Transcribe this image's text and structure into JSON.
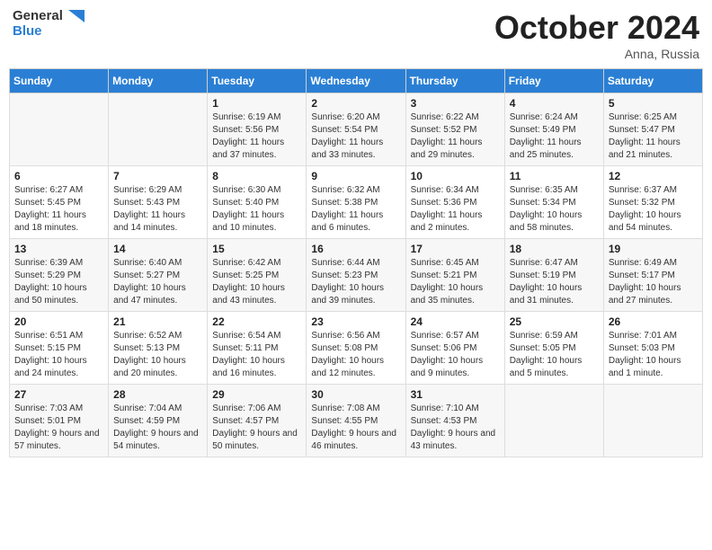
{
  "header": {
    "logo_line1": "General",
    "logo_line2": "Blue",
    "month": "October 2024",
    "location": "Anna, Russia"
  },
  "weekdays": [
    "Sunday",
    "Monday",
    "Tuesday",
    "Wednesday",
    "Thursday",
    "Friday",
    "Saturday"
  ],
  "weeks": [
    [
      {
        "day": "",
        "info": ""
      },
      {
        "day": "",
        "info": ""
      },
      {
        "day": "1",
        "info": "Sunrise: 6:19 AM\nSunset: 5:56 PM\nDaylight: 11 hours and 37 minutes."
      },
      {
        "day": "2",
        "info": "Sunrise: 6:20 AM\nSunset: 5:54 PM\nDaylight: 11 hours and 33 minutes."
      },
      {
        "day": "3",
        "info": "Sunrise: 6:22 AM\nSunset: 5:52 PM\nDaylight: 11 hours and 29 minutes."
      },
      {
        "day": "4",
        "info": "Sunrise: 6:24 AM\nSunset: 5:49 PM\nDaylight: 11 hours and 25 minutes."
      },
      {
        "day": "5",
        "info": "Sunrise: 6:25 AM\nSunset: 5:47 PM\nDaylight: 11 hours and 21 minutes."
      }
    ],
    [
      {
        "day": "6",
        "info": "Sunrise: 6:27 AM\nSunset: 5:45 PM\nDaylight: 11 hours and 18 minutes."
      },
      {
        "day": "7",
        "info": "Sunrise: 6:29 AM\nSunset: 5:43 PM\nDaylight: 11 hours and 14 minutes."
      },
      {
        "day": "8",
        "info": "Sunrise: 6:30 AM\nSunset: 5:40 PM\nDaylight: 11 hours and 10 minutes."
      },
      {
        "day": "9",
        "info": "Sunrise: 6:32 AM\nSunset: 5:38 PM\nDaylight: 11 hours and 6 minutes."
      },
      {
        "day": "10",
        "info": "Sunrise: 6:34 AM\nSunset: 5:36 PM\nDaylight: 11 hours and 2 minutes."
      },
      {
        "day": "11",
        "info": "Sunrise: 6:35 AM\nSunset: 5:34 PM\nDaylight: 10 hours and 58 minutes."
      },
      {
        "day": "12",
        "info": "Sunrise: 6:37 AM\nSunset: 5:32 PM\nDaylight: 10 hours and 54 minutes."
      }
    ],
    [
      {
        "day": "13",
        "info": "Sunrise: 6:39 AM\nSunset: 5:29 PM\nDaylight: 10 hours and 50 minutes."
      },
      {
        "day": "14",
        "info": "Sunrise: 6:40 AM\nSunset: 5:27 PM\nDaylight: 10 hours and 47 minutes."
      },
      {
        "day": "15",
        "info": "Sunrise: 6:42 AM\nSunset: 5:25 PM\nDaylight: 10 hours and 43 minutes."
      },
      {
        "day": "16",
        "info": "Sunrise: 6:44 AM\nSunset: 5:23 PM\nDaylight: 10 hours and 39 minutes."
      },
      {
        "day": "17",
        "info": "Sunrise: 6:45 AM\nSunset: 5:21 PM\nDaylight: 10 hours and 35 minutes."
      },
      {
        "day": "18",
        "info": "Sunrise: 6:47 AM\nSunset: 5:19 PM\nDaylight: 10 hours and 31 minutes."
      },
      {
        "day": "19",
        "info": "Sunrise: 6:49 AM\nSunset: 5:17 PM\nDaylight: 10 hours and 27 minutes."
      }
    ],
    [
      {
        "day": "20",
        "info": "Sunrise: 6:51 AM\nSunset: 5:15 PM\nDaylight: 10 hours and 24 minutes."
      },
      {
        "day": "21",
        "info": "Sunrise: 6:52 AM\nSunset: 5:13 PM\nDaylight: 10 hours and 20 minutes."
      },
      {
        "day": "22",
        "info": "Sunrise: 6:54 AM\nSunset: 5:11 PM\nDaylight: 10 hours and 16 minutes."
      },
      {
        "day": "23",
        "info": "Sunrise: 6:56 AM\nSunset: 5:08 PM\nDaylight: 10 hours and 12 minutes."
      },
      {
        "day": "24",
        "info": "Sunrise: 6:57 AM\nSunset: 5:06 PM\nDaylight: 10 hours and 9 minutes."
      },
      {
        "day": "25",
        "info": "Sunrise: 6:59 AM\nSunset: 5:05 PM\nDaylight: 10 hours and 5 minutes."
      },
      {
        "day": "26",
        "info": "Sunrise: 7:01 AM\nSunset: 5:03 PM\nDaylight: 10 hours and 1 minute."
      }
    ],
    [
      {
        "day": "27",
        "info": "Sunrise: 7:03 AM\nSunset: 5:01 PM\nDaylight: 9 hours and 57 minutes."
      },
      {
        "day": "28",
        "info": "Sunrise: 7:04 AM\nSunset: 4:59 PM\nDaylight: 9 hours and 54 minutes."
      },
      {
        "day": "29",
        "info": "Sunrise: 7:06 AM\nSunset: 4:57 PM\nDaylight: 9 hours and 50 minutes."
      },
      {
        "day": "30",
        "info": "Sunrise: 7:08 AM\nSunset: 4:55 PM\nDaylight: 9 hours and 46 minutes."
      },
      {
        "day": "31",
        "info": "Sunrise: 7:10 AM\nSunset: 4:53 PM\nDaylight: 9 hours and 43 minutes."
      },
      {
        "day": "",
        "info": ""
      },
      {
        "day": "",
        "info": ""
      }
    ]
  ]
}
